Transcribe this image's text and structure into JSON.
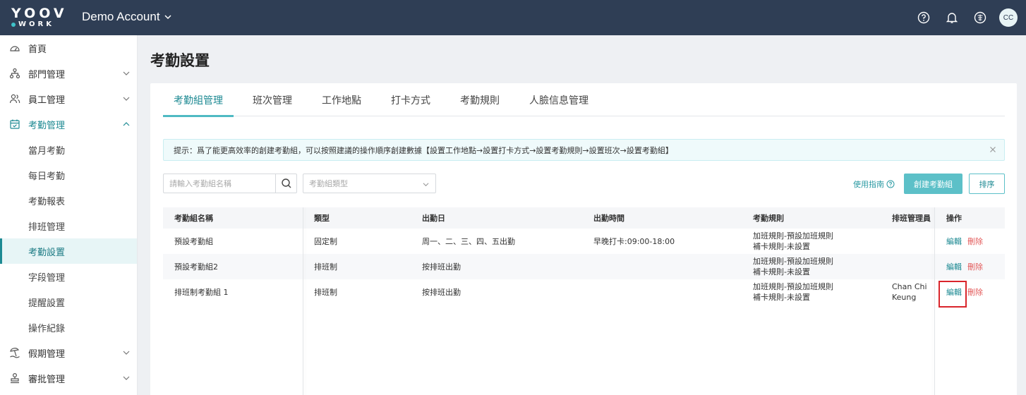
{
  "brand": {
    "line1": "YOOV",
    "line2": "WORK"
  },
  "account": {
    "name": "Demo Account"
  },
  "user": {
    "initials": "CC"
  },
  "sidebar": {
    "items": [
      {
        "label": "首頁",
        "icon": "dashboard-icon"
      },
      {
        "label": "部門管理",
        "icon": "org-chart-icon"
      },
      {
        "label": "員工管理",
        "icon": "users-icon"
      },
      {
        "label": "考勤管理",
        "icon": "calendar-check-icon"
      },
      {
        "label": "假期管理",
        "icon": "beach-icon"
      },
      {
        "label": "審批管理",
        "icon": "stamp-icon"
      }
    ],
    "sub_items": [
      "當月考勤",
      "每日考勤",
      "考勤報表",
      "排班管理",
      "考勤設置",
      "字段管理",
      "提醒設置",
      "操作紀錄"
    ]
  },
  "page": {
    "title": "考勤設置"
  },
  "tabs": [
    "考勤組管理",
    "班次管理",
    "工作地點",
    "打卡方式",
    "考勤規則",
    "人臉信息管理"
  ],
  "tip": {
    "text": "提示：爲了能更高效率的創建考勤組，可以按照建議的操作順序創建數據【設置工作地點→設置打卡方式→設置考勤規則→設置班次→設置考勤組】"
  },
  "filters": {
    "search_placeholder": "請輸入考勤組名稱",
    "type_placeholder": "考勤組類型"
  },
  "actions": {
    "guide": "使用指南",
    "create": "創建考勤組",
    "sort": "排序"
  },
  "table": {
    "headers": [
      "考勤組名稱",
      "類型",
      "出勤日",
      "出勤時間",
      "考勤規則",
      "排班管理員",
      "操作"
    ],
    "rows": [
      {
        "name": "預設考勤組",
        "type": "固定制",
        "days": "周一、二、三、四、五出勤",
        "time": "早晚打卡:09:00-18:00",
        "rule1": "加班規則-預設加班規則",
        "rule2": "補卡規則-未設置",
        "admin1": "",
        "admin2": ""
      },
      {
        "name": "預設考勤組2",
        "type": "排班制",
        "days": "按排班出勤",
        "time": "",
        "rule1": "加班規則-預設加班規則",
        "rule2": "補卡規則-未設置",
        "admin1": "",
        "admin2": ""
      },
      {
        "name": "排班制考勤組 1",
        "type": "排班制",
        "days": "按排班出勤",
        "time": "",
        "rule1": "加班規則-預設加班規則",
        "rule2": "補卡規則-未設置",
        "admin1": "Chan Chi",
        "admin2": "Keung"
      }
    ],
    "edit_label": "編輯",
    "delete_label": "刪除"
  },
  "colors": {
    "topbar": "#2f3e55",
    "accent": "#1e8a93",
    "danger": "#e35a5a",
    "highlight": "#d9252b"
  }
}
